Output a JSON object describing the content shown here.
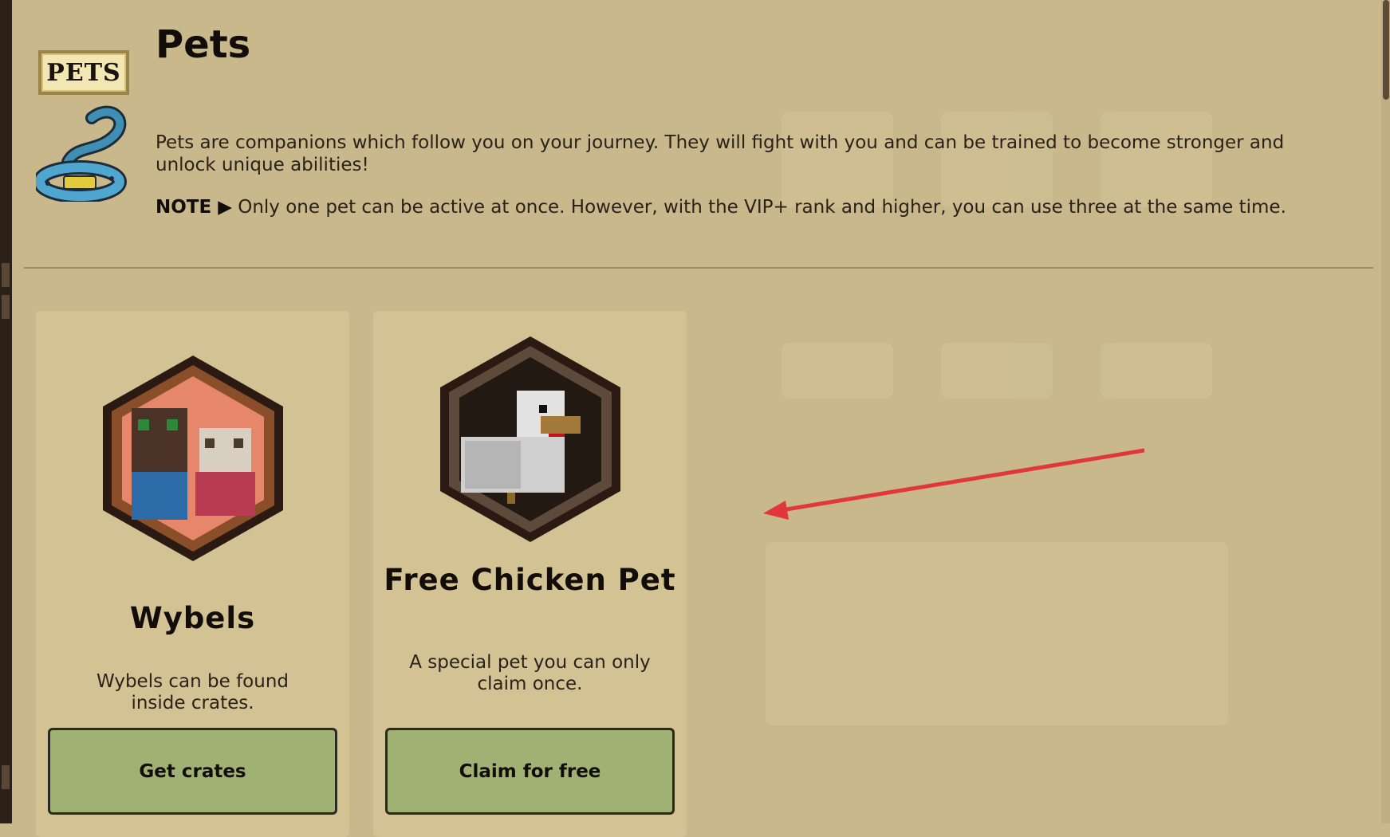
{
  "header": {
    "logo_tag": "PETS",
    "title": "Pets",
    "intro": "Pets are companions which follow you on your journey. They will fight with you and can be trained to become stronger and unlock unique abilities!",
    "note_label": "NOTE ▶",
    "note_text": "Only one pet can be active at once. However, with the VIP+ rank and higher, you can use three at the same time."
  },
  "cards": [
    {
      "title": "Wybels",
      "description": "Wybels can be found inside crates.",
      "button_label": "Get crates"
    },
    {
      "title": "Free Chicken Pet",
      "description": "A special pet you can only claim once.",
      "button_label": "Claim for free"
    }
  ],
  "icons": {
    "logo": "pets-tag-icon",
    "leash": "leash-icon",
    "card1_image": "wybels-hexagon-icon",
    "card2_image": "chicken-hexagon-icon",
    "annotation": "red-arrow-icon"
  },
  "colors": {
    "page_bg": "#c8b88b",
    "card_bg": "#d3c294",
    "button_bg": "#9fb273",
    "arrow": "#e0383a"
  }
}
